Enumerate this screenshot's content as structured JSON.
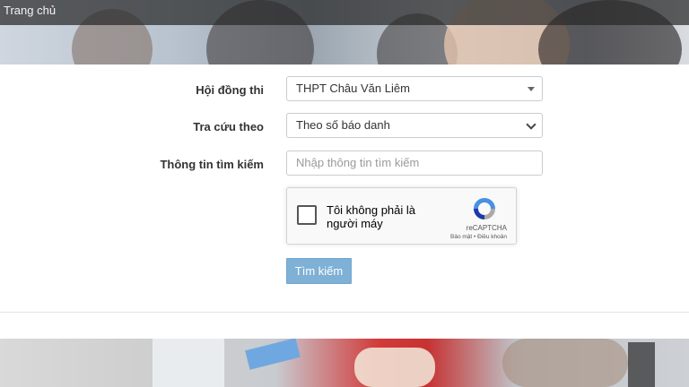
{
  "nav": {
    "home_label": "Trang chủ"
  },
  "form": {
    "exam_council": {
      "label": "Hội đồng thi",
      "selected": "THPT Châu Văn Liêm"
    },
    "lookup_by": {
      "label": "Tra cứu theo",
      "selected": "Theo số báo danh"
    },
    "search_info": {
      "label": "Thông tin tìm kiếm",
      "placeholder": "Nhập thông tin tìm kiếm"
    },
    "submit_label": "Tìm kiếm"
  },
  "recaptcha": {
    "text": "Tôi không phải là người máy",
    "brand": "reCAPTCHA",
    "links": "Bảo mật • Điều khoản"
  },
  "colors": {
    "button": "#7fb0d5",
    "nav_bar": "#282828"
  }
}
